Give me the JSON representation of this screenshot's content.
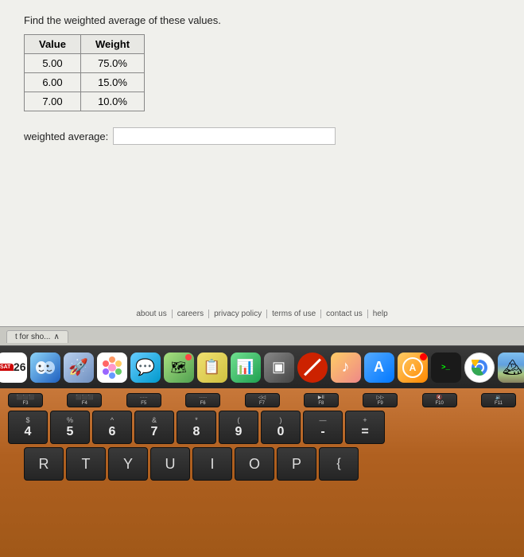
{
  "screen": {
    "problem_text": "Find the weighted average of these values.",
    "table": {
      "headers": [
        "Value",
        "Weight"
      ],
      "rows": [
        {
          "value": "5.00",
          "weight": "75.0%"
        },
        {
          "value": "6.00",
          "weight": "15.0%"
        },
        {
          "value": "7.00",
          "weight": "10.0%"
        }
      ]
    },
    "weighted_avg_label": "weighted average:",
    "weighted_avg_placeholder": ""
  },
  "footer": {
    "links": [
      "about us",
      "careers",
      "privacy policy",
      "terms of use",
      "contact us",
      "help"
    ]
  },
  "tab_bar": {
    "tab_label": "t for sho..."
  },
  "dock": {
    "icons": [
      {
        "name": "calendar",
        "label": "26"
      },
      {
        "name": "finder",
        "label": "🗂"
      },
      {
        "name": "launchpad",
        "label": "🚀"
      },
      {
        "name": "photos",
        "label": "🌸"
      },
      {
        "name": "messages",
        "label": "💬"
      },
      {
        "name": "maps",
        "label": "🗺"
      },
      {
        "name": "notes",
        "label": "📝"
      },
      {
        "name": "charts",
        "label": "📊"
      },
      {
        "name": "airplay",
        "label": "📺"
      },
      {
        "name": "no-sign",
        "label": ""
      },
      {
        "name": "music",
        "label": "♪"
      },
      {
        "name": "appstore",
        "label": "A"
      },
      {
        "name": "activity",
        "label": "⚙"
      },
      {
        "name": "terminal",
        "label": ">_"
      },
      {
        "name": "chrome",
        "label": ""
      },
      {
        "name": "landscape",
        "label": "🏔"
      }
    ]
  },
  "keyboard": {
    "fn_row": [
      "F3\n⬛⬛⬛",
      "F4\n⬛⬛⬛",
      "F5\n·····",
      "F6\n·····",
      "F7\n◁◁",
      "F8\nDII",
      "F9\n▷▷",
      "F10\n◁",
      "F11\n◁)"
    ],
    "num_row": [
      {
        "top": "$",
        "main": "4"
      },
      {
        "top": "%",
        "main": "5"
      },
      {
        "top": "^",
        "main": "6"
      },
      {
        "top": "&",
        "main": "7"
      },
      {
        "top": "*",
        "main": "8"
      },
      {
        "top": "(",
        "main": "9"
      },
      {
        "top": ")",
        "main": "0"
      },
      {
        "top": "—",
        "main": "-"
      },
      {
        "top": "+",
        "main": "="
      }
    ],
    "letter_row": [
      "R",
      "T",
      "Y",
      "U",
      "I",
      "O",
      "P",
      "{"
    ]
  }
}
